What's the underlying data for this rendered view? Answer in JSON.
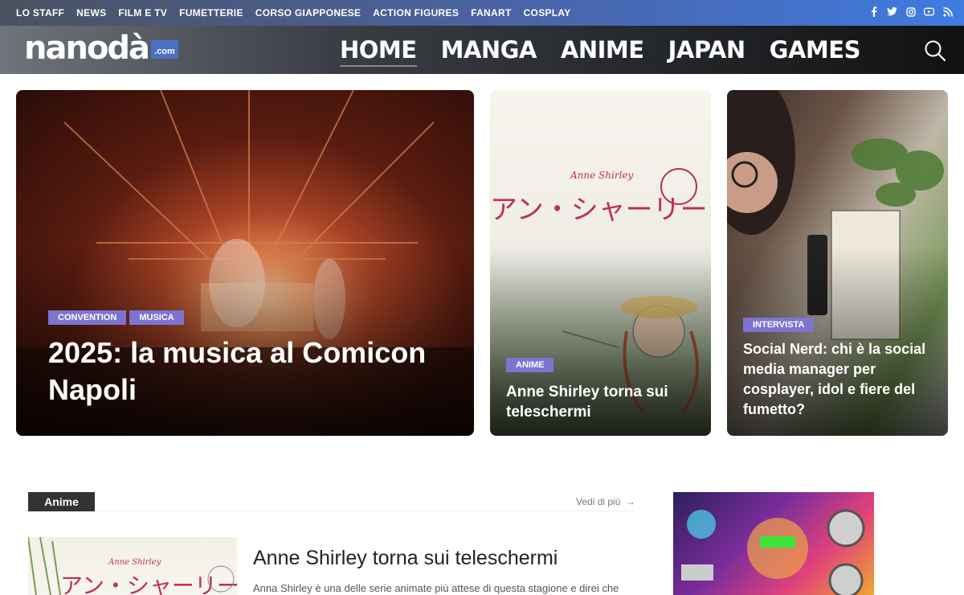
{
  "topbar": {
    "links": [
      "LO STAFF",
      "NEWS",
      "FILM E TV",
      "FUMETTERIE",
      "CORSO GIAPPONESE",
      "ACTION FIGURES",
      "FANART",
      "COSPLAY"
    ],
    "social_icons": [
      "facebook-icon",
      "twitter-icon",
      "instagram-icon",
      "youtube-icon",
      "rss-icon"
    ]
  },
  "header": {
    "logo_word": "nanodà",
    "logo_suffix": ".com",
    "nav": [
      "HOME",
      "MANGA",
      "ANIME",
      "JAPAN",
      "GAMES"
    ],
    "active_nav": "HOME"
  },
  "hero": [
    {
      "tags": [
        "CONVENTION",
        "MUSICA"
      ],
      "title": "2025: la musica al Comicon Napoli"
    },
    {
      "tags": [
        "ANIME"
      ],
      "title": "Anne Shirley torna sui teleschermi",
      "art_text": [
        "Anne Shirley",
        "アン・シャーリー"
      ]
    },
    {
      "tags": [
        "INTERVISTA"
      ],
      "title": "Social Nerd: chi è la social media manager per cosplayer, idol e fiere del fumetto?"
    }
  ],
  "section": {
    "label": "Anime",
    "see_more": "Vedi di più",
    "article": {
      "title": "Anne Shirley torna sui teleschermi",
      "excerpt": "Anna Shirley è una delle serie animate più attese di questa stagione e direi che"
    }
  },
  "colors": {
    "tag": "#7d74d0",
    "topbar_start": "#4a5260",
    "topbar_end": "#3f7be0"
  }
}
